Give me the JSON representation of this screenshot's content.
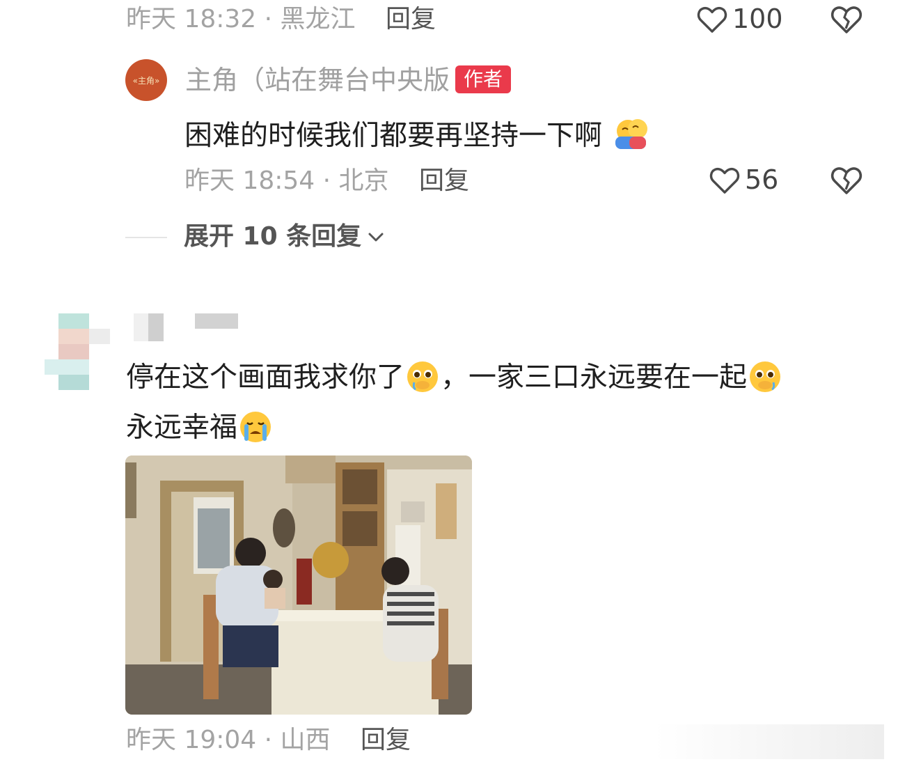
{
  "top_comment_meta": {
    "time_location": "昨天 18:32 · 黑龙江",
    "reply_label": "回复",
    "like_count": "100"
  },
  "author_reply": {
    "avatar_text": "«主角»",
    "name": "主角（站在舞台中央版",
    "badge": "作者",
    "text": "困难的时候我们都要再坚持一下啊",
    "emoji": "hugging-face-icon",
    "time_location": "昨天 18:54 · 北京",
    "reply_label": "回复",
    "like_count": "56"
  },
  "expand_replies": {
    "label": "展开 10 条回复"
  },
  "comment": {
    "text_line1_part1": "停在这个画面我求你了",
    "text_line1_part2": "，一家三口永远要在一起",
    "text_line2": "永远幸福",
    "time_location": "昨天 19:04 · 山西",
    "reply_label": "回复",
    "image_icon": "family-dinner-photo"
  },
  "colors": {
    "badge": "#ea3a4b",
    "avatar": "#c8522b",
    "meta_gray": "#a3a3a3"
  }
}
